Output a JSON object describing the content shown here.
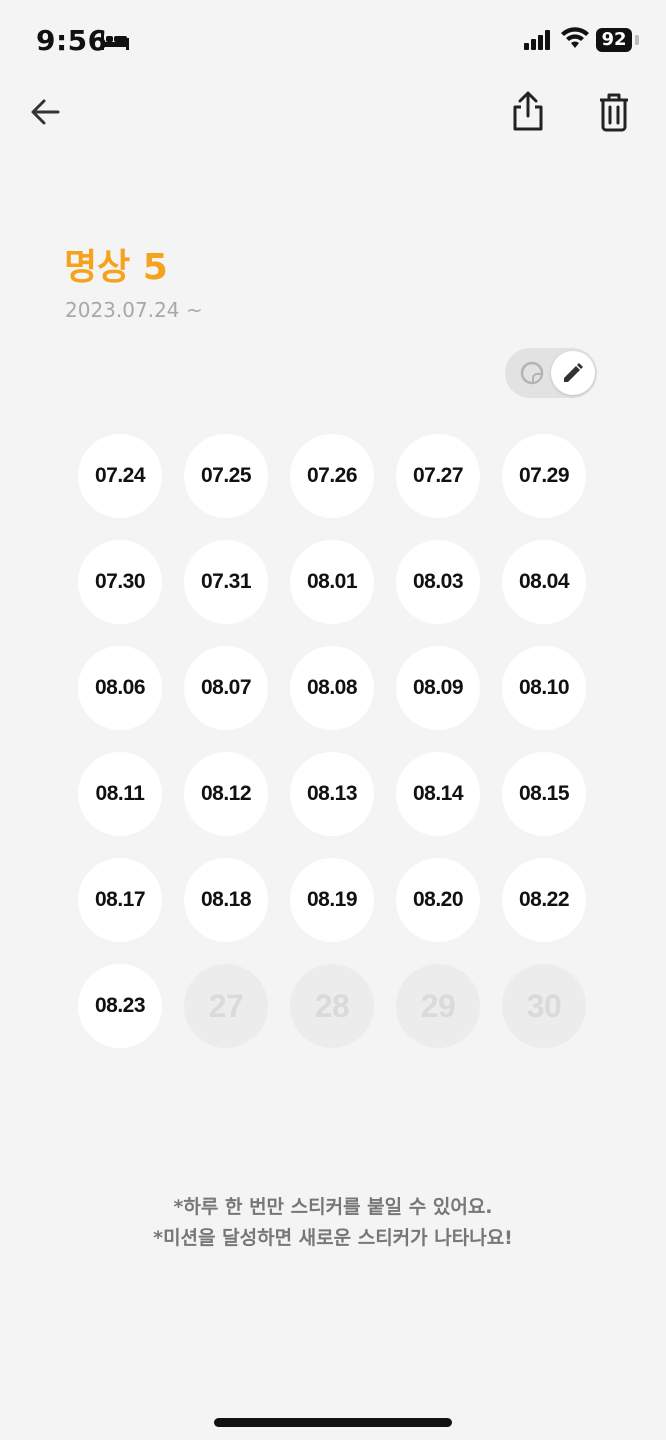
{
  "status_bar": {
    "time": "9:56",
    "battery": "92",
    "icons": [
      "bed-icon",
      "signal-icon",
      "wifi-icon",
      "battery-icon"
    ]
  },
  "nav": {
    "icons": [
      "back-arrow-icon",
      "share-icon",
      "trash-icon"
    ]
  },
  "header": {
    "title": "명상 5",
    "subtitle": "2023.07.24 ~"
  },
  "toggle": {
    "left_icon": "sticker-icon",
    "right_icon": "pencil-icon",
    "selected": "pencil"
  },
  "colors": {
    "accent": "#f5a21c",
    "background": "#f4f4f4",
    "filled_cell": "#ffffff",
    "empty_cell": "#ececec"
  },
  "stickers": {
    "filled": [
      "07.24",
      "07.25",
      "07.26",
      "07.27",
      "07.29",
      "07.30",
      "07.31",
      "08.01",
      "08.03",
      "08.04",
      "08.06",
      "08.07",
      "08.08",
      "08.09",
      "08.10",
      "08.11",
      "08.12",
      "08.13",
      "08.14",
      "08.15",
      "08.17",
      "08.18",
      "08.19",
      "08.20",
      "08.22",
      "08.23"
    ],
    "empty": [
      "27",
      "28",
      "29",
      "30"
    ]
  },
  "notes": {
    "line1": "*하루 한 번만 스티커를 붙일 수 있어요.",
    "line2": "*미션을 달성하면 새로운 스티커가 나타나요!"
  }
}
